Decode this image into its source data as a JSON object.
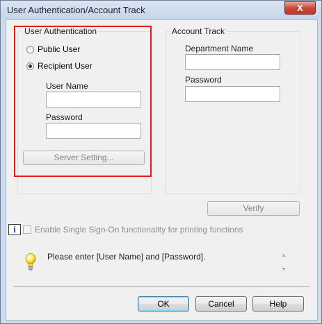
{
  "window": {
    "title": "User Authentication/Account Track",
    "close_label": "X"
  },
  "user_auth": {
    "group_title": "User Authentication",
    "public_user_label": "Public User",
    "recipient_user_label": "Recipient User",
    "selected": "Recipient User",
    "user_name_label": "User Name",
    "user_name_value": "",
    "password_label": "Password",
    "password_value": "",
    "server_setting_label": "Server Setting..."
  },
  "account_track": {
    "group_title": "Account Track",
    "department_name_label": "Department Name",
    "department_name_value": "",
    "password_label": "Password",
    "password_value": "",
    "verify_label": "Verify"
  },
  "sso": {
    "info_icon": "i",
    "label": "Enable Single Sign-On functionality for printing functions",
    "checked": false
  },
  "message": {
    "text": "Please enter [User Name] and [Password]."
  },
  "footer": {
    "ok_label": "OK",
    "cancel_label": "Cancel",
    "help_label": "Help"
  },
  "colors": {
    "highlight": "#e21a1a",
    "close_button": "#c74b36",
    "title_bar": "#cfdcec"
  }
}
